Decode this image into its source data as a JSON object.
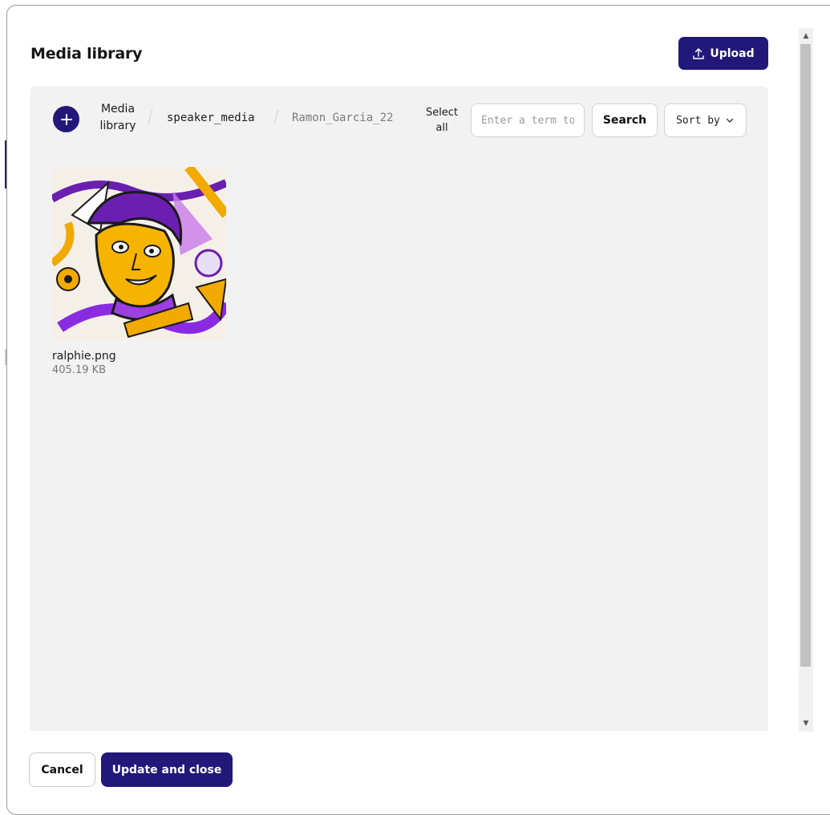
{
  "modal": {
    "title": "Media library",
    "upload_label": "Upload"
  },
  "toolbar": {
    "breadcrumbs": [
      "Media library",
      "speaker_media",
      "Ramon_Garcia_22"
    ],
    "select_all_label": "Select all",
    "search_placeholder": "Enter a term to search",
    "search_label": "Search",
    "sort_label": "Sort by"
  },
  "files": [
    {
      "name": "ralphie.png",
      "size": "405.19 KB"
    }
  ],
  "footer": {
    "cancel_label": "Cancel",
    "update_label": "Update and close"
  },
  "colors": {
    "accent": "#22187a",
    "panel_bg": "#f2f2f2"
  },
  "icons": {
    "upload": "upload-icon",
    "add": "plus-circle-icon",
    "sort": "chevron-down-icon"
  }
}
